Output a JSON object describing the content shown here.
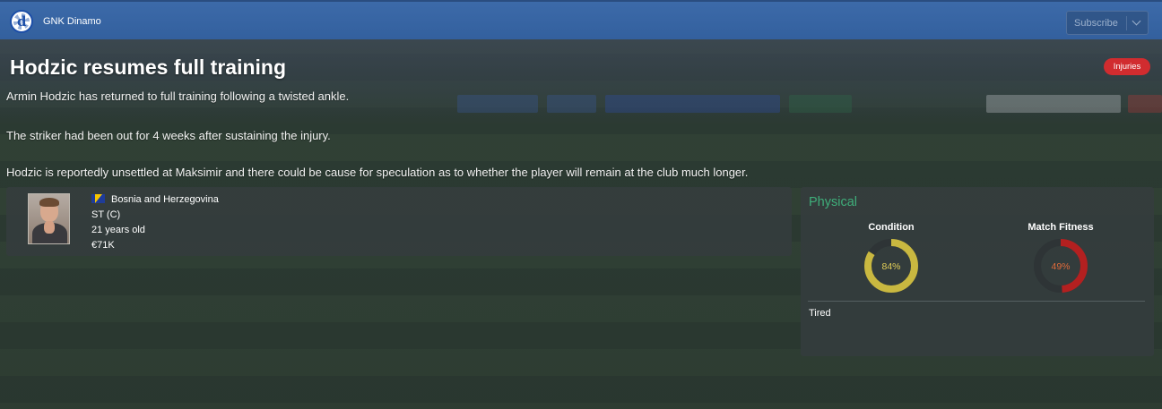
{
  "header": {
    "club_name": "GNK Dinamo",
    "logo_letter": "d",
    "subscribe_label": "Subscribe"
  },
  "article": {
    "title": "Hodzic resumes full training",
    "tag": "Injuries",
    "tag_color": "#d12c2f",
    "paragraphs": [
      "Armin Hodzic has returned to full training following a twisted ankle.",
      "The striker had been out for 4 weeks after sustaining the injury.",
      "Hodzic is reportedly unsettled at Maksimir and there could be cause for speculation as to whether the player will remain at the club much longer."
    ]
  },
  "player": {
    "nationality": "Bosnia and Herzegovina",
    "position": "ST (C)",
    "age": "21 years old",
    "value": "€71K",
    "flag_icon": "bosnia-flag-icon"
  },
  "physical": {
    "title": "Physical",
    "title_color": "#3fae7a",
    "condition": {
      "label": "Condition",
      "value_text": "84%",
      "fraction": 0.84,
      "color": "#c9b840"
    },
    "match_fitness": {
      "label": "Match Fitness",
      "value_text": "49%",
      "fraction": 0.49,
      "color": "#b32020"
    },
    "status": "Tired"
  }
}
